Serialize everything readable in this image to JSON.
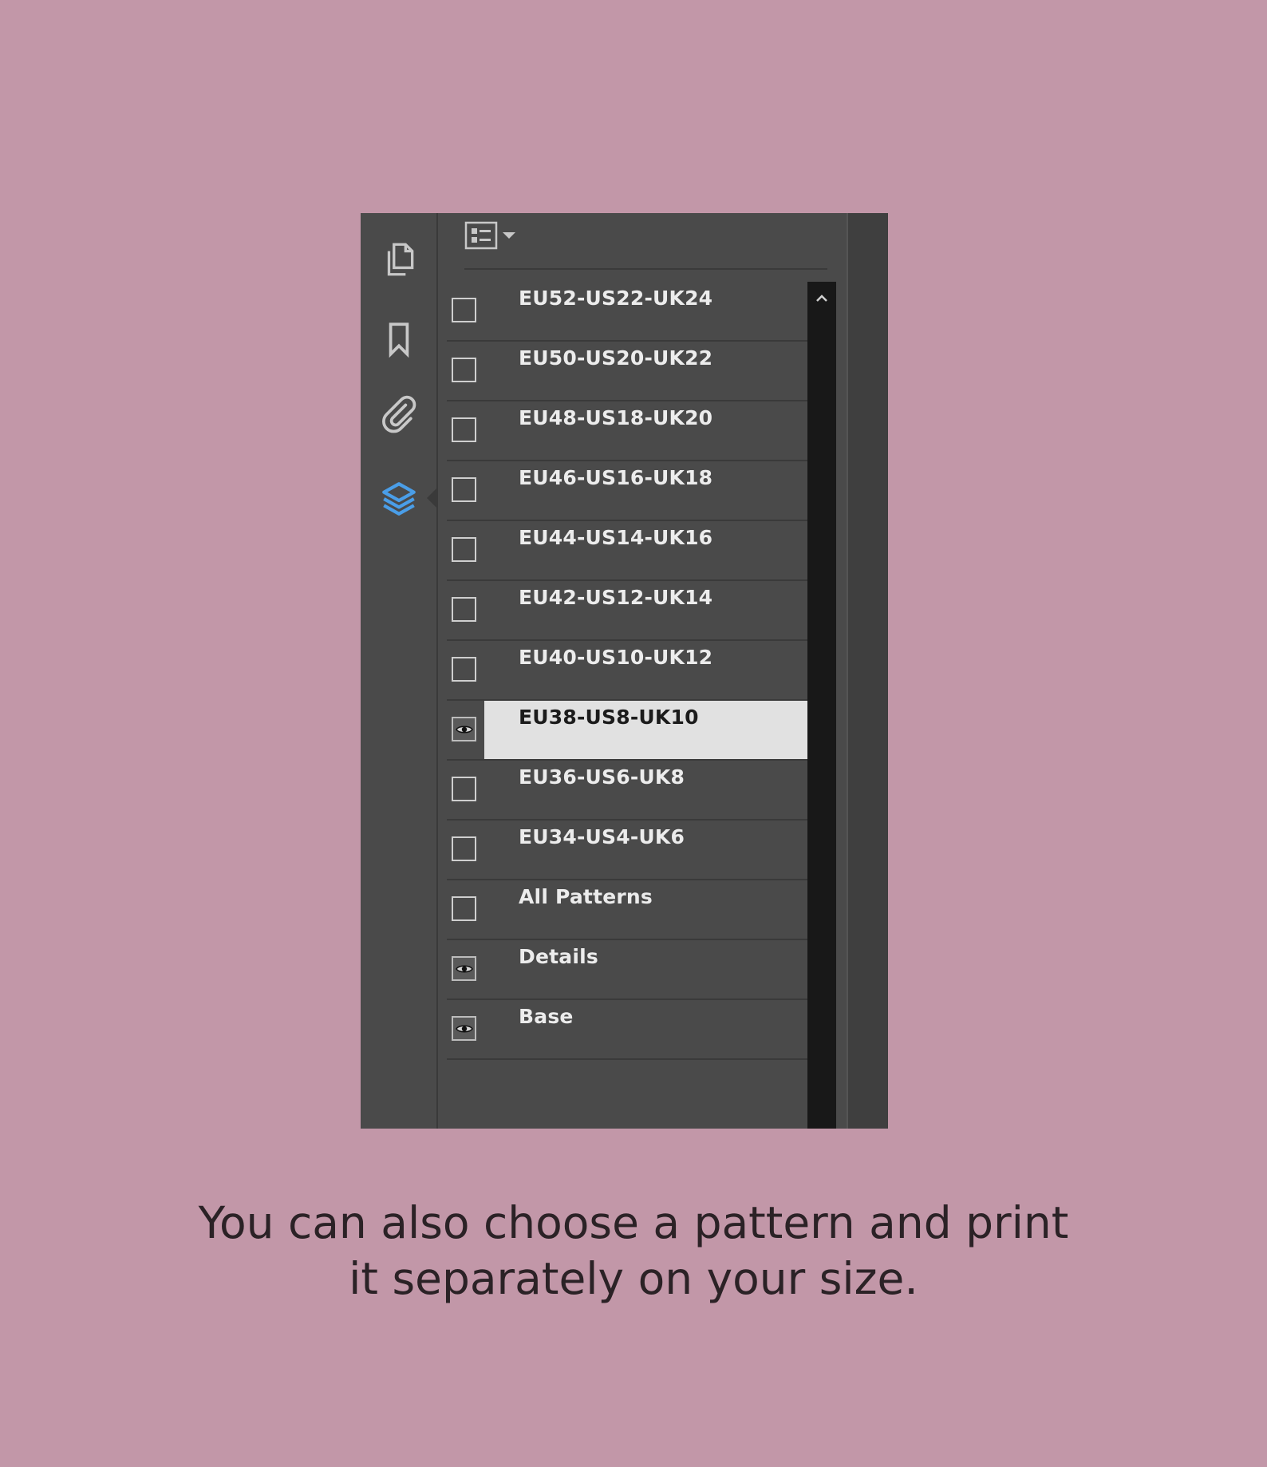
{
  "side_rail": {
    "icons": [
      "pages-icon",
      "bookmark-icon",
      "paperclip-icon",
      "layers-icon"
    ],
    "active": "layers-icon",
    "active_color": "#4a9ee8"
  },
  "toolbar": {
    "options_icon": "list-options-icon",
    "dropdown_icon": "chevron-down-icon"
  },
  "layers": [
    {
      "label": "EU52-US22-UK24",
      "visible": false,
      "selected": false
    },
    {
      "label": "EU50-US20-UK22",
      "visible": false,
      "selected": false
    },
    {
      "label": "EU48-US18-UK20",
      "visible": false,
      "selected": false
    },
    {
      "label": "EU46-US16-UK18",
      "visible": false,
      "selected": false
    },
    {
      "label": "EU44-US14-UK16",
      "visible": false,
      "selected": false
    },
    {
      "label": "EU42-US12-UK14",
      "visible": false,
      "selected": false
    },
    {
      "label": "EU40-US10-UK12",
      "visible": false,
      "selected": false
    },
    {
      "label": "EU38-US8-UK10",
      "visible": true,
      "selected": true
    },
    {
      "label": "EU36-US6-UK8",
      "visible": false,
      "selected": false
    },
    {
      "label": "EU34-US4-UK6",
      "visible": false,
      "selected": false
    },
    {
      "label": "All Patterns",
      "visible": false,
      "selected": false
    },
    {
      "label": "Details",
      "visible": true,
      "selected": false
    },
    {
      "label": "Base",
      "visible": true,
      "selected": false
    }
  ],
  "caption": {
    "line1": "You can also choose a pattern and print",
    "line2": "it separately on your size."
  }
}
